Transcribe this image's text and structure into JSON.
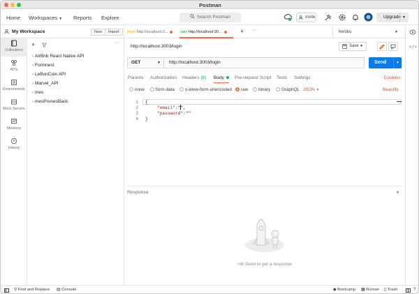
{
  "window": {
    "title": "Postman"
  },
  "topnav": {
    "home": "Home",
    "workspaces": "Workspaces",
    "reports": "Reports",
    "explore": "Explore"
  },
  "search": {
    "placeholder": "Search Postman"
  },
  "header_actions": {
    "invite": "Invite",
    "upgrade": "Upgrade"
  },
  "workspace": {
    "name": "My Workspace",
    "new_label": "New",
    "import_label": "Import"
  },
  "rail": [
    {
      "label": "Collections",
      "icon": "collections-icon"
    },
    {
      "label": "APIs",
      "icon": "apis-icon"
    },
    {
      "label": "Environments",
      "icon": "environments-icon"
    },
    {
      "label": "Mock Servers",
      "icon": "mock-servers-icon"
    },
    {
      "label": "Monitors",
      "icon": "monitors-icon"
    },
    {
      "label": "History",
      "icon": "history-icon"
    }
  ],
  "collections": [
    {
      "name": "AirBnb React Native API"
    },
    {
      "name": "Formnest"
    },
    {
      "name": "LeBonCoin API"
    },
    {
      "name": "Marvel_API"
    },
    {
      "name": "mes"
    },
    {
      "name": "mesPrunesBack"
    }
  ],
  "tabs": [
    {
      "method": "POST",
      "url": "http://localhost:3...",
      "method_color": "#ffb400"
    },
    {
      "method": "GET",
      "url": "http://localhost:30...",
      "method_color": "#0cbb52"
    }
  ],
  "environment": {
    "selected": "heroku"
  },
  "request": {
    "title": "http://localhost:3003/login",
    "save_label": "Save",
    "method": "GET",
    "url": "http://localhost:3003/login",
    "send_label": "Send"
  },
  "request_tabs": {
    "params": "Params",
    "authorization": "Authorization",
    "headers": "Headers",
    "headers_count": "(8)",
    "body": "Body",
    "prerequest": "Pre-request Script",
    "tests": "Tests",
    "settings": "Settings",
    "cookies": "Cookies"
  },
  "body_options": {
    "none": "none",
    "form_data": "form-data",
    "urlencoded": "x-www-form-urlencoded",
    "raw": "raw",
    "binary": "binary",
    "graphql": "GraphQL",
    "format": "JSON",
    "beautify": "Beautify"
  },
  "editor": {
    "line_numbers": [
      "1",
      "2",
      "3",
      "4"
    ],
    "line1": "{",
    "line2_key": "\"email\"",
    "line2_rest": ":\"\",",
    "line3_key": "\"password\"",
    "line3_rest": ":\"\"",
    "line4": "}"
  },
  "response": {
    "label": "Response",
    "hint": "Hit Send to get a response"
  },
  "statusbar": {
    "find_replace": "Find and Replace",
    "console": "Console",
    "bootcamp": "Bootcamp",
    "runner": "Runner",
    "trash": "Trash"
  },
  "colors": {
    "accent": "#ff6c37",
    "send": "#097bed",
    "post": "#ffb400",
    "get": "#0cbb52"
  }
}
